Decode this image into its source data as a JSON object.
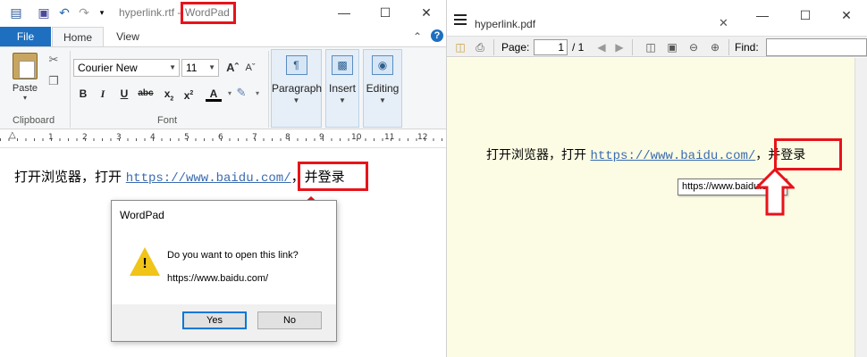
{
  "wordpad": {
    "title_file": "hyperlink.rtf - ",
    "title_app": "WordPad",
    "tabs": {
      "file": "File",
      "home": "Home",
      "view": "View"
    },
    "clipboard": {
      "paste_label": "Paste",
      "group_label": "Clipboard"
    },
    "font": {
      "family": "Courier New",
      "size": "11",
      "group_label": "Font"
    },
    "paragraph_label": "Paragraph",
    "insert_label": "Insert",
    "editing_label": "Editing",
    "ruler_numbers": [
      "1",
      "2",
      "3",
      "4",
      "5",
      "6",
      "7",
      "8",
      "9",
      "10",
      "11",
      "12"
    ],
    "document": {
      "prefix": "打开浏览器，打开 ",
      "link": "https://www.baidu.com/",
      "suffix": "，并登录"
    }
  },
  "dialog": {
    "title": "WordPad",
    "message": "Do you want to open this link?",
    "url": "https://www.baidu.com/",
    "yes_label": "Yes",
    "no_label": "No"
  },
  "pdf": {
    "tab_title": "hyperlink.pdf",
    "page_label": "Page:",
    "page_current": "1",
    "page_total": "/ 1",
    "find_label": "Find:",
    "document": {
      "prefix": "打开浏览器，打开 ",
      "link": "https://www.baidu.com/",
      "suffix": "，并登录"
    },
    "tooltip": "https://www.baidu.com/"
  },
  "colors": {
    "annotation": "#e8131a",
    "accent": "#1e6fbf",
    "link": "#3a6bb0",
    "pdf_page_bg": "#fcfce4"
  }
}
